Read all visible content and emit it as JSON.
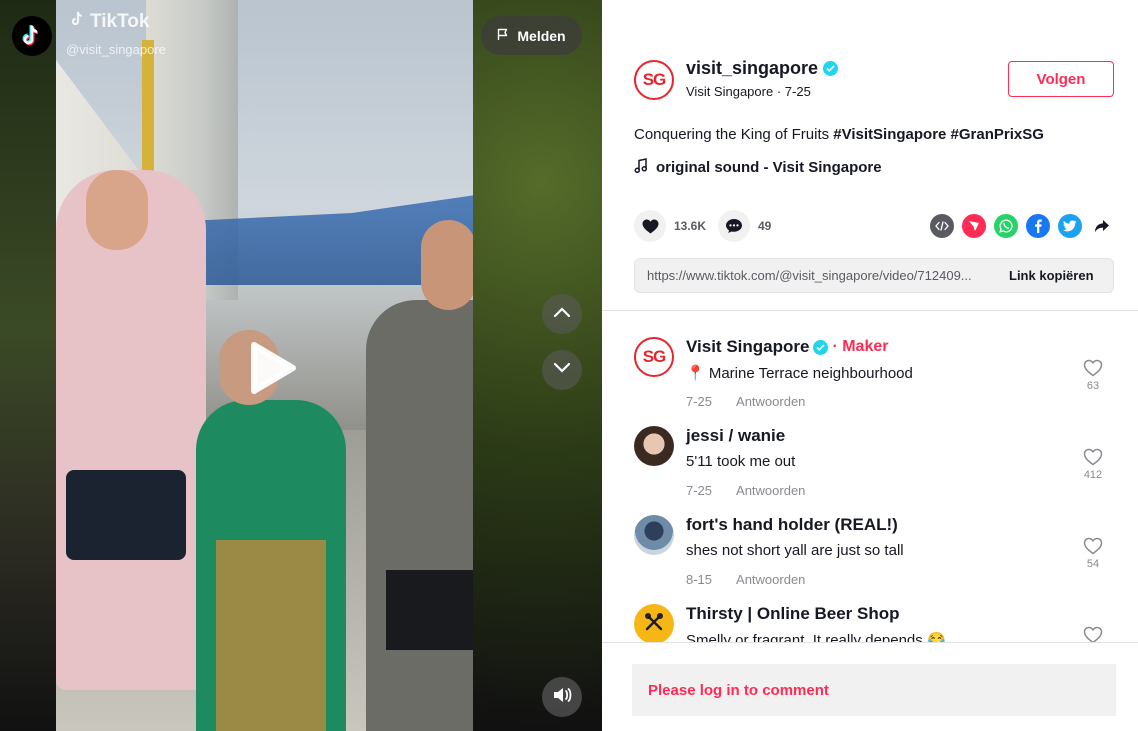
{
  "video": {
    "brand": "TikTok",
    "watermark_handle": "@visit_singapore",
    "report_label": "Melden"
  },
  "author": {
    "username": "visit_singapore",
    "display_name": "Visit Singapore",
    "date": "7-25",
    "avatar_text": "SG",
    "follow_label": "Volgen"
  },
  "post": {
    "caption_text": "Conquering the King of Fruits ",
    "hashtags": [
      "#VisitSingapore",
      "#GranPrixSG"
    ],
    "sound": "original sound - Visit Singapore",
    "likes": "13.6K",
    "comments": "49",
    "link_url": "https://www.tiktok.com/@visit_singapore/video/712409...",
    "copy_link_label": "Link kopiëren"
  },
  "comments": [
    {
      "name": "Visit Singapore",
      "badge": "· Maker",
      "text": "📍 Marine Terrace neighbourhood",
      "date": "7-25",
      "reply_label": "Antwoorden",
      "likes": "63",
      "avatar": "sg-logo"
    },
    {
      "name": "jessi / wanie",
      "text": "5'11 took me out",
      "date": "7-25",
      "reply_label": "Antwoorden",
      "likes": "412",
      "avatar": "photo"
    },
    {
      "name": "fort's hand holder (REAL!)",
      "text": "shes not short yall are just so tall",
      "date": "8-15",
      "reply_label": "Antwoorden",
      "likes": "54",
      "avatar": "photo"
    },
    {
      "name": "Thirsty | Online Beer Shop",
      "text": "Smelly or fragrant. It really depends 😂",
      "date": "",
      "reply_label": "",
      "likes": "",
      "avatar": "beer-logo"
    }
  ],
  "footer": {
    "login_label": "Please log in to comment"
  },
  "colors": {
    "accent": "#fe2c55",
    "sg_red": "#e6262e",
    "verified": "#20d5ec"
  }
}
